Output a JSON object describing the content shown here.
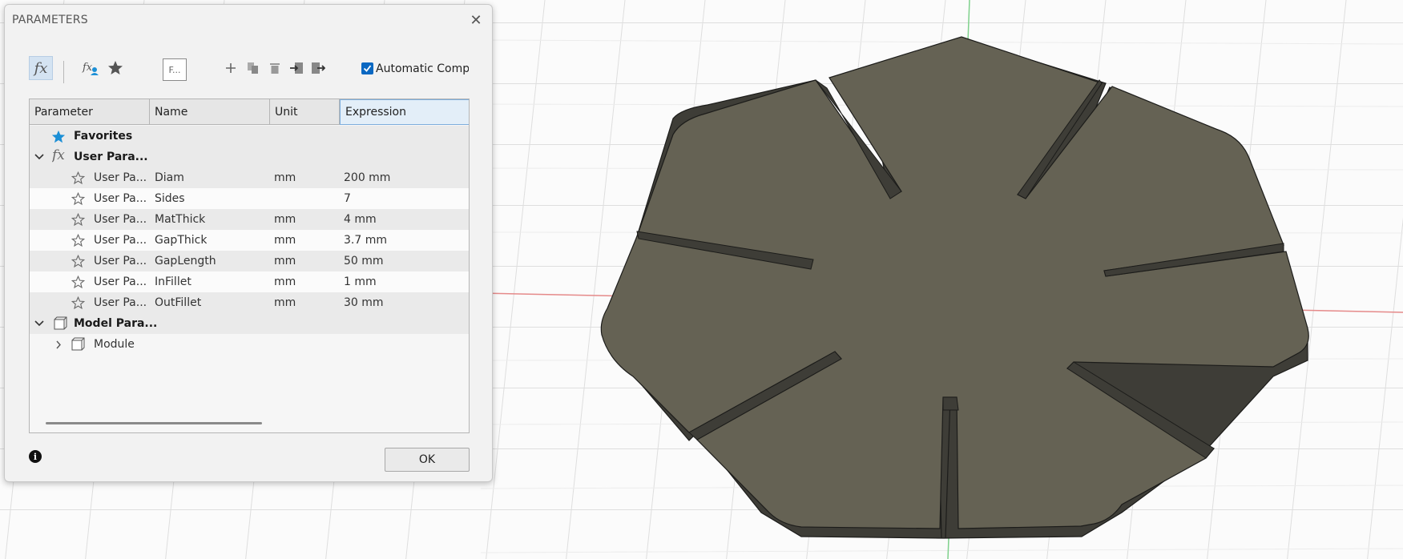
{
  "dialog": {
    "title": "PARAMETERS",
    "filter_placeholder": "F...",
    "auto_compute_label": "Automatic Compute",
    "auto_compute_checked": true,
    "ok_label": "OK"
  },
  "table": {
    "headers": [
      "Parameter",
      "Name",
      "Unit",
      "Expression"
    ],
    "favorites_label": "Favorites",
    "user_group_label": "User Para...",
    "model_group_label": "Model Para...",
    "module_label": "Module",
    "rows": [
      {
        "type": "User Pa...",
        "name": "Diam",
        "unit": "mm",
        "expr": "200 mm"
      },
      {
        "type": "User Pa...",
        "name": "Sides",
        "unit": "",
        "expr": "7"
      },
      {
        "type": "User Pa...",
        "name": "MatThick",
        "unit": "mm",
        "expr": "4 mm"
      },
      {
        "type": "User Pa...",
        "name": "GapThick",
        "unit": "mm",
        "expr": "3.7 mm"
      },
      {
        "type": "User Pa...",
        "name": "GapLength",
        "unit": "mm",
        "expr": "50 mm"
      },
      {
        "type": "User Pa...",
        "name": "InFillet",
        "unit": "mm",
        "expr": "1 mm"
      },
      {
        "type": "User Pa...",
        "name": "OutFillet",
        "unit": "mm",
        "expr": "30 mm"
      }
    ]
  },
  "icons": {
    "fx": "fx-icon",
    "user_fx": "user-fx-icon",
    "star": "star-icon",
    "add": "plus-icon",
    "copy": "copy-icon",
    "delete": "trash-icon",
    "import": "import-icon",
    "export": "export-icon",
    "info": "info-icon"
  },
  "colors": {
    "accent": "#0b68c2",
    "favorite_star": "#1b8fd6",
    "part_top": "#656254",
    "part_edge": "#3e3d37",
    "grid_axis_x": "#e58a8a",
    "grid_axis_y": "#7fd18c"
  }
}
